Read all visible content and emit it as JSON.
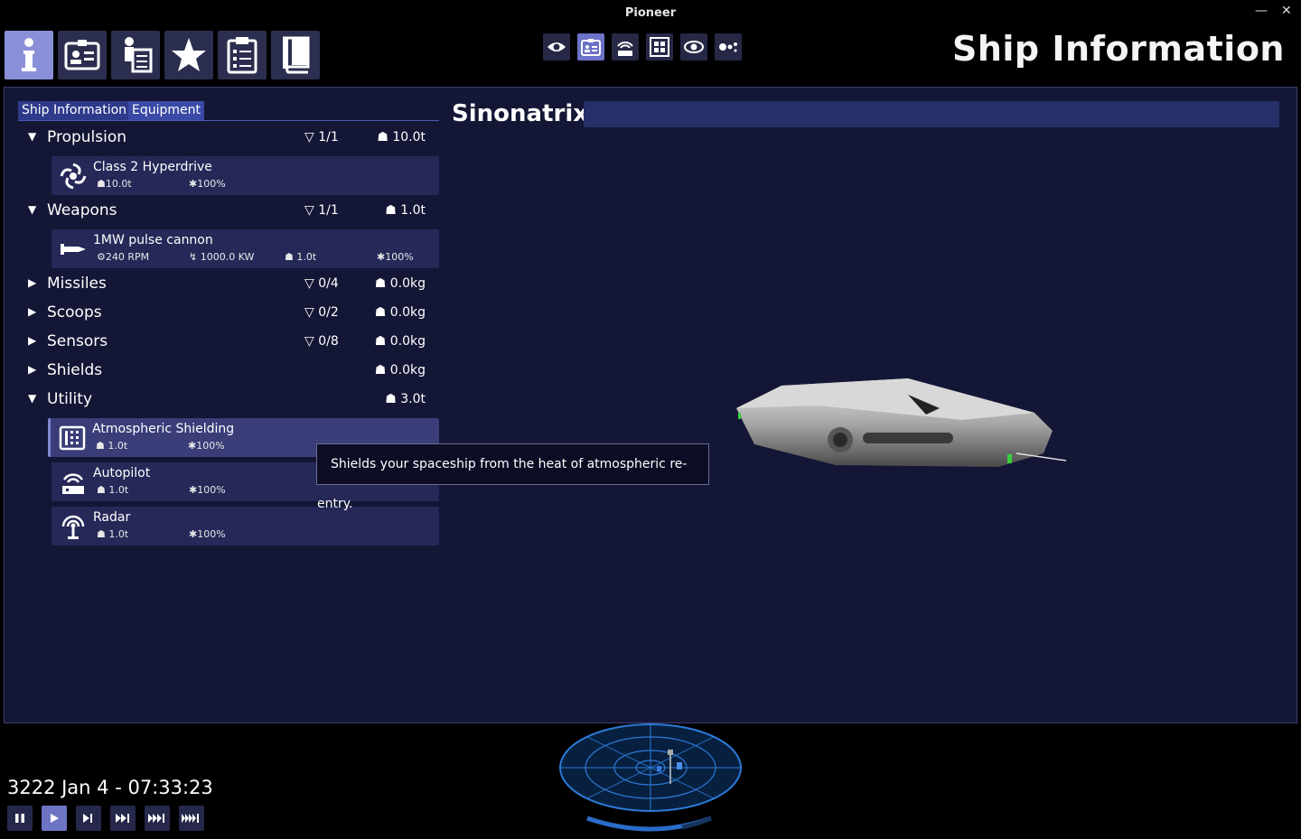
{
  "window": {
    "title": "Pioneer"
  },
  "header": {
    "title": "Ship Information",
    "main_buttons": [
      {
        "icon": "info-icon",
        "active": true
      },
      {
        "icon": "id-card-icon",
        "active": false
      },
      {
        "icon": "crew-icon",
        "active": false
      },
      {
        "icon": "star-icon",
        "active": false
      },
      {
        "icon": "clipboard-icon",
        "active": false
      },
      {
        "icon": "book-icon",
        "active": false
      }
    ],
    "view_buttons": [
      {
        "icon": "eye-icon",
        "active": false
      },
      {
        "icon": "info-card-icon",
        "active": true
      },
      {
        "icon": "radio-icon",
        "active": false
      },
      {
        "icon": "grid-icon",
        "active": false
      },
      {
        "icon": "orbit-icon",
        "active": false
      },
      {
        "icon": "system-icon",
        "active": false
      }
    ]
  },
  "tabs": [
    "Ship Information",
    "Equipment"
  ],
  "ship": {
    "name": "Sinonatrix"
  },
  "equipment": {
    "propulsion": {
      "name": "Propulsion",
      "slots": "1/1",
      "mass": "10.0t"
    },
    "hyperdrive": {
      "name": "Class 2 Hyperdrive",
      "mass": "10.0t",
      "condition": "100%"
    },
    "weapons": {
      "name": "Weapons",
      "slots": "1/1",
      "mass": "1.0t"
    },
    "pulse": {
      "name": "1MW pulse cannon",
      "rpm": "240 RPM",
      "power": "1000.0 KW",
      "mass": "1.0t",
      "condition": "100%"
    },
    "missiles": {
      "name": "Missiles",
      "slots": "0/4",
      "mass": "0.0kg"
    },
    "scoops": {
      "name": "Scoops",
      "slots": "0/2",
      "mass": "0.0kg"
    },
    "sensors": {
      "name": "Sensors",
      "slots": "0/8",
      "mass": "0.0kg"
    },
    "shields": {
      "name": "Shields",
      "slots": "",
      "mass": "0.0kg"
    },
    "utility": {
      "name": "Utility",
      "slots": "",
      "mass": "3.0t"
    },
    "atmo": {
      "name": "Atmospheric Shielding",
      "mass": "1.0t",
      "condition": "100%"
    },
    "autopilot": {
      "name": "Autopilot",
      "mass": "1.0t",
      "condition": "100%"
    },
    "radar": {
      "name": "Radar",
      "mass": "1.0t",
      "condition": "100%"
    }
  },
  "tooltip": "Shields your spaceship from the heat of atmospheric re-entry.",
  "footer": {
    "datetime": "3222 Jan 4 - 07:33:23",
    "time_controls": [
      {
        "icon": "pause-icon",
        "active": false
      },
      {
        "icon": "play-icon",
        "active": true
      },
      {
        "icon": "fast-forward-1-icon",
        "active": false
      },
      {
        "icon": "fast-forward-2-icon",
        "active": false
      },
      {
        "icon": "fast-forward-3-icon",
        "active": false
      },
      {
        "icon": "fast-forward-4-icon",
        "active": false
      }
    ]
  },
  "colors": {
    "panel_bg": "#141635",
    "item_bg": "#262858",
    "accent": "#6b72c7",
    "active_button": "#8a90d8"
  }
}
